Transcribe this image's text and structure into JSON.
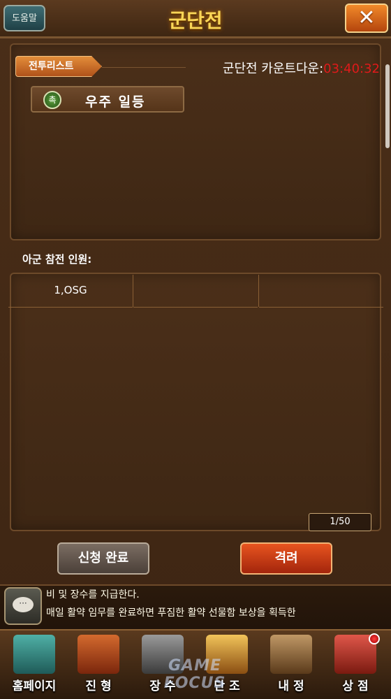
{
  "header": {
    "help_label": "도움말",
    "title": "군단전",
    "close_label": "✕"
  },
  "battle_list": {
    "tab_label": "전투리스트",
    "countdown_label": "군단전 카운트다운:",
    "countdown_time": "03:40:32",
    "guild_icon_label": "촉",
    "guild_name": "우주 일등"
  },
  "members": {
    "label": "아군 참전 인원:",
    "rows": [
      [
        "1,OSG",
        "",
        ""
      ]
    ],
    "page_indicator": "1/50"
  },
  "actions": {
    "applied_label": "신청 완료",
    "attack_label": "격려"
  },
  "chat": {
    "icon_label": "···",
    "lines": [
      "비 및 장수를 지급한다.",
      "매일 활약 임무를 완료하면 푸짐한 활약 선물함 보상을 획득한"
    ]
  },
  "nav": {
    "items": [
      {
        "label": "홈페이지",
        "icon": "pagoda-icon",
        "color": "#3a8c8a"
      },
      {
        "label": "진 형",
        "icon": "war-drum-icon",
        "color": "#b8451c"
      },
      {
        "label": "장 수",
        "icon": "general-helmet-icon",
        "color": "#6b6b6b"
      },
      {
        "label": "단 조",
        "icon": "forge-anvil-icon",
        "color": "#d89a2a"
      },
      {
        "label": "내 정",
        "icon": "treasure-chest-icon",
        "color": "#8a6a3e"
      },
      {
        "label": "상 점",
        "icon": "card-pack-icon",
        "color": "#c53a2a"
      }
    ]
  },
  "watermark": "GAME FOCUS"
}
